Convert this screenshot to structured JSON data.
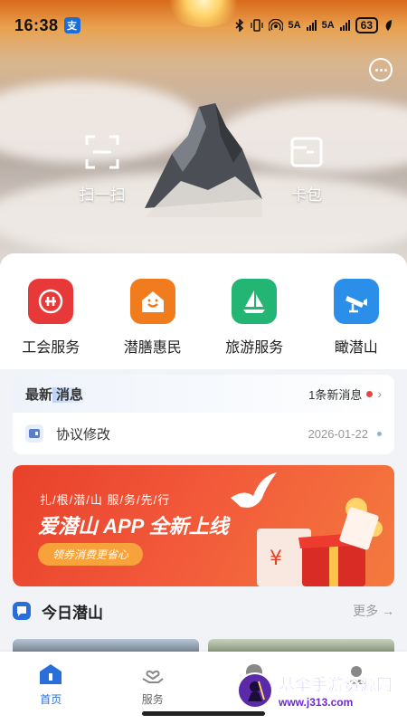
{
  "status_bar": {
    "time": "16:38",
    "app_badge": "支",
    "network_1": "5A",
    "network_2": "5A",
    "battery": "63"
  },
  "hero": {
    "scan_label": "扫一扫",
    "wallet_label": "卡包"
  },
  "quick_services": [
    {
      "label": "工会服务",
      "icon": "union-icon",
      "color": "#e8393a"
    },
    {
      "label": "潜膳惠民",
      "icon": "house-smile-icon",
      "color": "#f07c1e"
    },
    {
      "label": "旅游服务",
      "icon": "sailboat-icon",
      "color": "#22b573"
    },
    {
      "label": "瞰潜山",
      "icon": "camera-icon",
      "color": "#2b8ee8"
    }
  ],
  "news": {
    "title_prefix": "最新",
    "title_highlight": "消息",
    "count_text": "1条新消息",
    "item_text": "协议修改",
    "item_date": "2026-01-22"
  },
  "banner": {
    "subtitle": "扎/根/潜/山  服/务/先/行",
    "headline": "爱潜山 APP 全新上线",
    "pill": "领券消费更省心"
  },
  "today": {
    "title": "今日潜山",
    "more": "更多 →"
  },
  "tabs": [
    {
      "label": "首页",
      "active": true
    },
    {
      "label": "服务",
      "active": false
    }
  ],
  "watermark": {
    "line1": "基伞手游资源网",
    "line2": "www.j313.com"
  },
  "colors": {
    "accent": "#2a6fd9",
    "red": "#e54545"
  }
}
